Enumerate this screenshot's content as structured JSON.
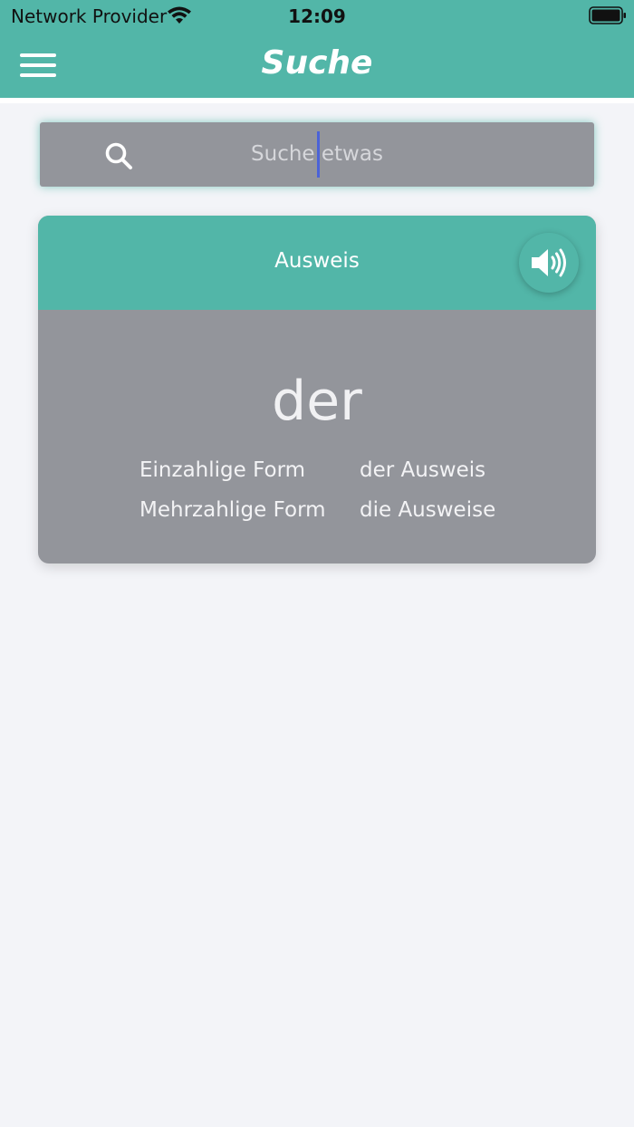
{
  "status_bar": {
    "carrier": "Network Provider",
    "time": "12:09",
    "wifi_icon": "wifi-icon",
    "battery_icon": "battery-icon"
  },
  "header": {
    "title": "Suche",
    "menu_icon": "hamburger-menu-icon",
    "background_color": "#52b6a8"
  },
  "search": {
    "placeholder": "Suche etwas",
    "icon": "search-icon"
  },
  "card": {
    "word": "Ausweis",
    "speaker_icon": "speaker-icon",
    "article": "der",
    "forms": [
      {
        "label": "Einzahlige Form",
        "value": "der Ausweis"
      },
      {
        "label": "Mehrzahlige Form",
        "value": "die Ausweise"
      }
    ]
  },
  "colors": {
    "accent": "#52b6a8",
    "card_body": "#93959b",
    "page_background": "#f3f4f8",
    "caret": "#4b63d8"
  }
}
